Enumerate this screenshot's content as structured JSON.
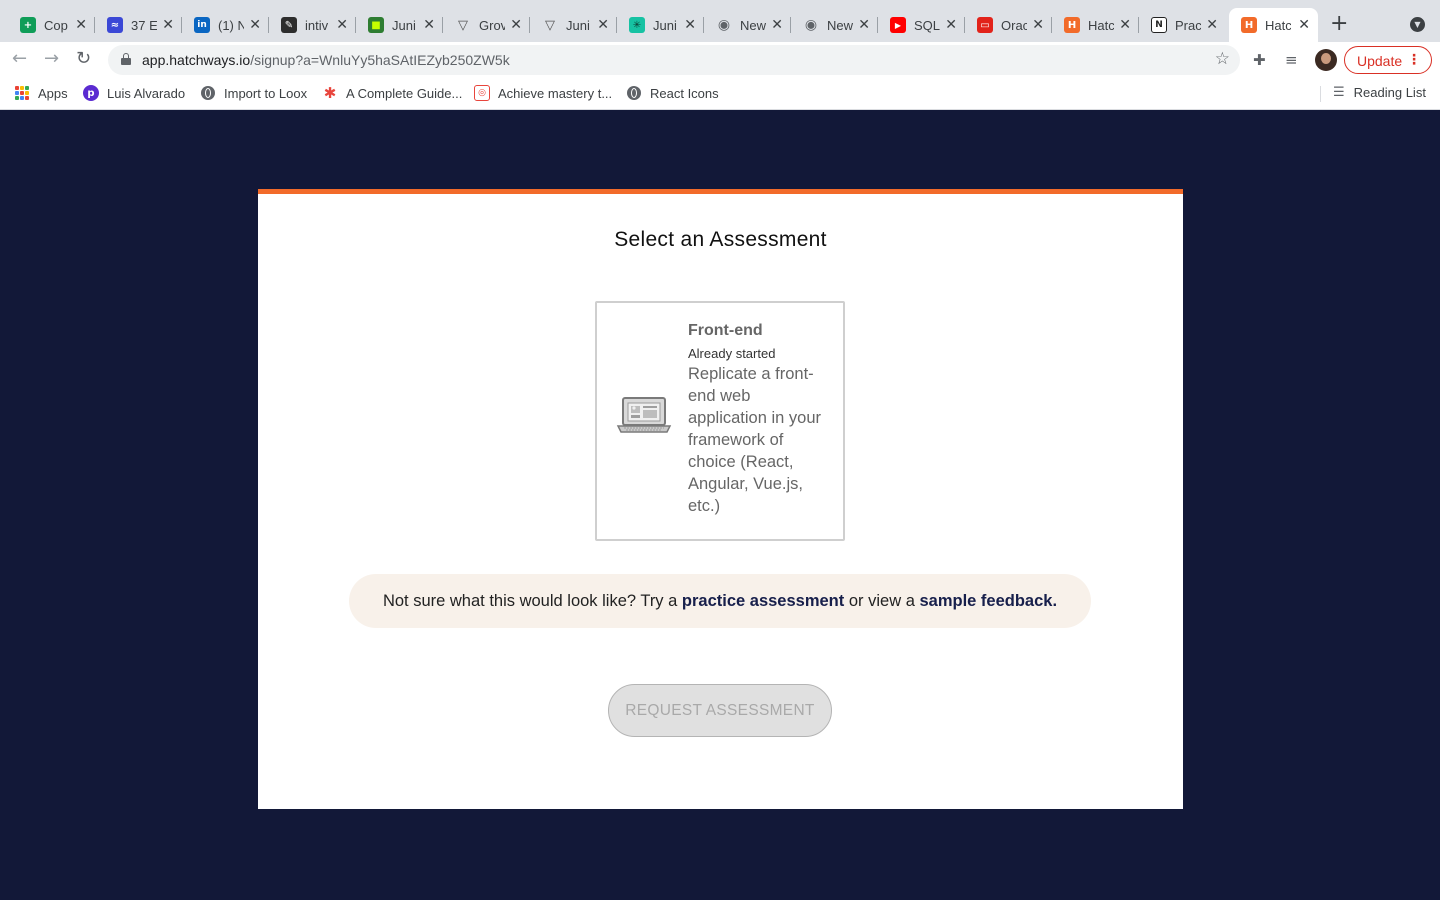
{
  "browser": {
    "tabs": [
      {
        "title": "Cop",
        "icon": "sheets-icon",
        "color": "#0f9d58",
        "glyph": "+"
      },
      {
        "title": "37 E",
        "icon": "blue-app-icon",
        "color": "#3b48d6",
        "glyph": "≈"
      },
      {
        "title": "(1) N",
        "icon": "linkedin-icon",
        "color": "#0a66c2",
        "glyph": "in"
      },
      {
        "title": "intiv",
        "icon": "pen-icon",
        "color": "#2d2d2d",
        "glyph": "✎"
      },
      {
        "title": "Juni",
        "icon": "green-app-icon",
        "color": "#2e7d32",
        "glyph": "■"
      },
      {
        "title": "Grov",
        "icon": "triangle-icon",
        "color": "#555555",
        "glyph": "▽"
      },
      {
        "title": "Juni",
        "icon": "triangle-icon",
        "color": "#555555",
        "glyph": "▽"
      },
      {
        "title": "Juni",
        "icon": "teal-app-icon",
        "color": "#16c2a3",
        "glyph": "✳"
      },
      {
        "title": "New",
        "icon": "chrome-icon",
        "color": "#5f6368",
        "glyph": "◉"
      },
      {
        "title": "New",
        "icon": "chrome-icon",
        "color": "#5f6368",
        "glyph": "◉"
      },
      {
        "title": "SQL",
        "icon": "youtube-icon",
        "color": "#ff0000",
        "glyph": "▶"
      },
      {
        "title": "Orac",
        "icon": "oracle-icon",
        "color": "#e2231a",
        "glyph": "▭"
      },
      {
        "title": "Hatc",
        "icon": "hatchways-icon",
        "color": "#f26b2a",
        "glyph": "H"
      },
      {
        "title": "Prac",
        "icon": "notion-icon",
        "color": "#222222",
        "glyph": "N"
      },
      {
        "title": "Hatc",
        "icon": "hatchways-icon",
        "color": "#f26b2a",
        "glyph": "H"
      }
    ],
    "url_host": "app.hatchways.io",
    "url_path": "/signup?a=WnluYy5haSAtIEZyb250ZW5k",
    "update_label": "Update",
    "bookmarks": [
      {
        "label": "Apps",
        "icon": "apps-grid-icon"
      },
      {
        "label": "Luis Alvarado",
        "icon": "profile-p-icon"
      },
      {
        "label": "Import to Loox",
        "icon": "globe-icon"
      },
      {
        "label": "A Complete Guide...",
        "icon": "asterisk-icon"
      },
      {
        "label": "Achieve mastery t...",
        "icon": "codecademy-icon"
      },
      {
        "label": "React Icons",
        "icon": "globe-icon"
      }
    ],
    "reading_list": "Reading List"
  },
  "page": {
    "title": "Select an Assessment",
    "assessment": {
      "name": "Front-end",
      "status": "Already started",
      "description": "Replicate a front-end web application in your framework of choice (React, Angular, Vue.js, etc.)",
      "icon": "laptop-icon"
    },
    "hint": {
      "prefix": "Not sure what this would look like? Try a ",
      "practice_link": "practice assessment",
      "middle": " or view a ",
      "sample_link": "sample feedback",
      "suffix": "."
    },
    "request_button": "REQUEST ASSESSMENT"
  },
  "colors": {
    "background": "#121838",
    "accent": "#f26b2a",
    "link": "#171f4b",
    "hint_bg": "#f8f1ea"
  }
}
